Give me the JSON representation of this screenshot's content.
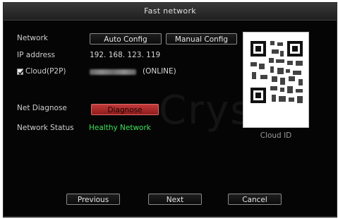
{
  "window": {
    "title": "Fast network"
  },
  "watermark": "Crysto",
  "form": {
    "network_label": "Network",
    "auto_config_label": "Auto Config",
    "manual_config_label": "Manual Config",
    "ip_label": "IP address",
    "ip_value": "192. 168. 123. 119",
    "cloud_label": "Cloud(P2P)",
    "cloud_checked": true,
    "cloud_status": "(ONLINE)",
    "net_diagnose_label": "Net Diagnose",
    "diagnose_label": "Diagnose",
    "network_status_label": "Network Status",
    "network_status_value": "Healthy Network"
  },
  "qr": {
    "caption": "Cloud ID"
  },
  "footer": {
    "previous_label": "Previous",
    "next_label": "Next",
    "cancel_label": "Cancel"
  },
  "colors": {
    "status_healthy": "#3fe15a",
    "diagnose_button": "#b52e2e",
    "background": "#050505"
  }
}
